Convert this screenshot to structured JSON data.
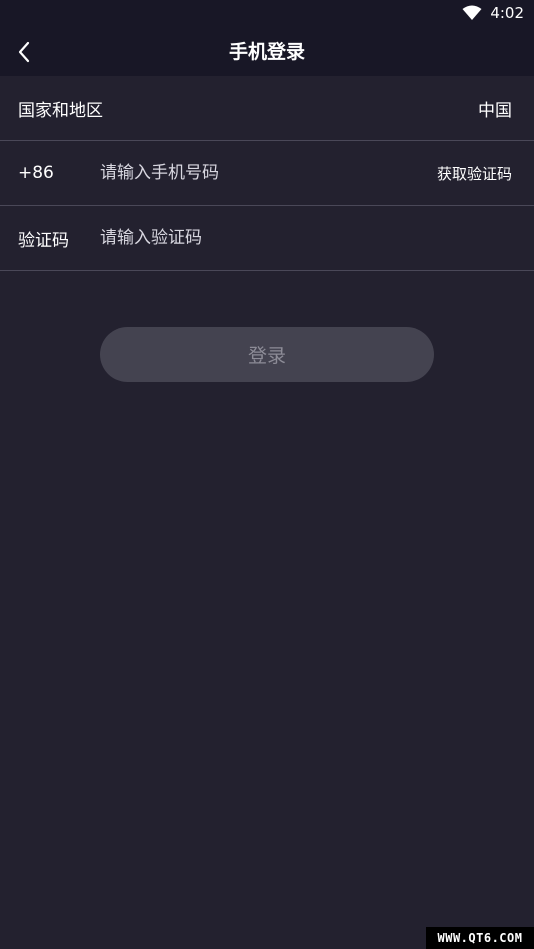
{
  "status_bar": {
    "time": "4:02",
    "wifi_icon": "wifi-icon"
  },
  "header": {
    "back_icon": "chevron-left-icon",
    "title": "手机登录"
  },
  "form": {
    "region_row": {
      "label": "国家和地区",
      "value": "中国"
    },
    "phone_row": {
      "country_code": "+86",
      "placeholder": "请输入手机号码",
      "value": "",
      "get_code_label": "获取验证码"
    },
    "code_row": {
      "label": "验证码",
      "placeholder": "请输入验证码",
      "value": ""
    }
  },
  "login_button": {
    "label": "登录"
  },
  "watermark": {
    "text": "WWW.QT6.COM"
  },
  "colors": {
    "background": "#23212f",
    "header_background": "#181726",
    "button_background": "#444350",
    "button_text": "#8d8c97",
    "divider": "#4a4858"
  }
}
